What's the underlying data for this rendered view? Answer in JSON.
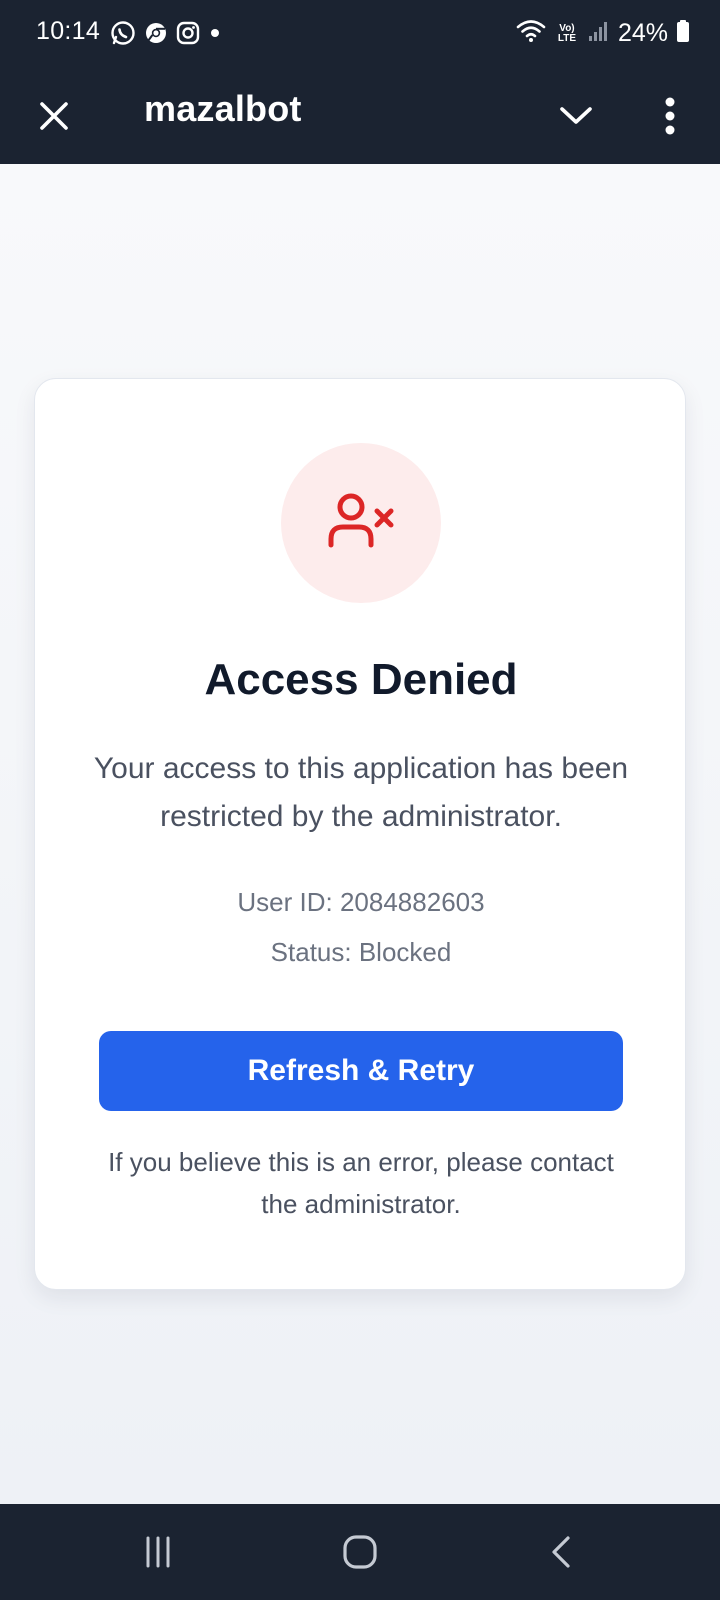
{
  "status_bar": {
    "time": "10:14",
    "notification_icons": [
      "whatsapp-icon",
      "chrome-icon",
      "instagram-icon",
      "dot-icon"
    ],
    "signal_label": "Vo) LTE",
    "battery": "24%"
  },
  "app_bar": {
    "title": "mazalbot",
    "close_icon": "close-icon",
    "chevron_icon": "chevron-down-icon",
    "more_icon": "more-vertical-icon"
  },
  "card": {
    "icon": "user-blocked-icon",
    "title": "Access Denied",
    "message": "Your access to this application has been restricted by the administrator.",
    "user_id": "User ID: 2084882603",
    "status": "Status: Blocked",
    "retry_button": "Refresh & Retry",
    "help_text": "If you believe this is an error, please contact the administrator."
  },
  "colors": {
    "header_bg": "#1b2331",
    "accent": "#2563eb",
    "danger": "#dc2626",
    "danger_bg": "#fdecec"
  },
  "nav_bar": {
    "recents_icon": "recents-icon",
    "home_icon": "home-icon",
    "back_icon": "back-icon"
  }
}
